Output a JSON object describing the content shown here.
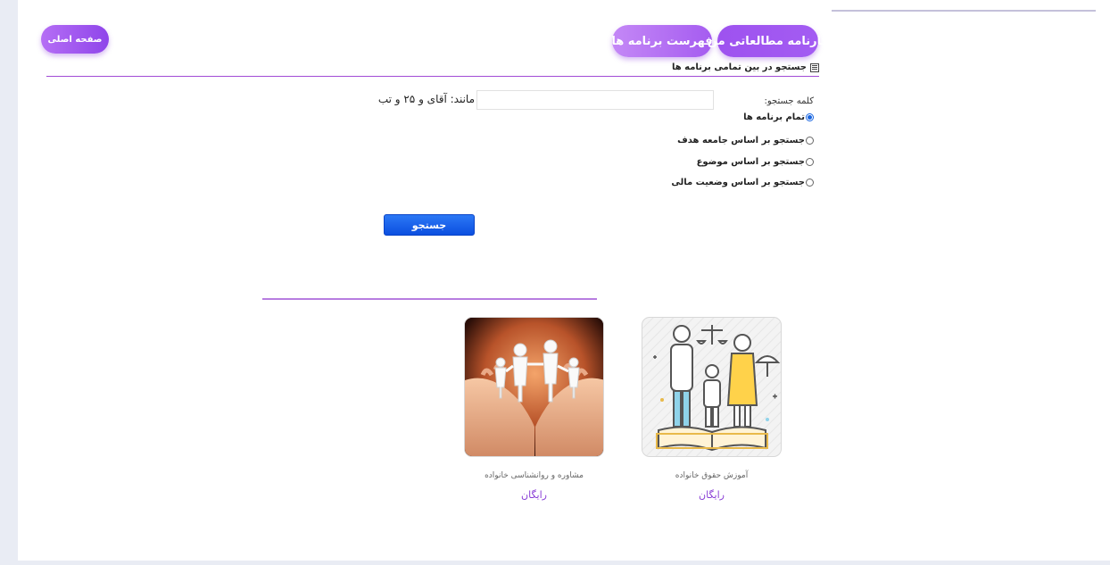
{
  "nav": {
    "home_label": "صفحه اصلی",
    "program_list_label": "فهرست برنامه ها",
    "my_report_label": "کارنامه مطالعاتی من"
  },
  "search": {
    "section_title": "جستجو در بین تمامی برنامه ها",
    "keyword_label": "کلمه جستجو:",
    "keyword_value": "",
    "keyword_hint": "مانند: آقای و ۲۵ و تب",
    "options": [
      {
        "label": "تمام برنامه ها",
        "checked": true
      },
      {
        "label": "جستجو بر اساس جامعه هدف",
        "checked": false
      },
      {
        "label": "جستجو بر اساس موضوع",
        "checked": false
      },
      {
        "label": "جستجو بر اساس وضعیت مالی",
        "checked": false
      }
    ],
    "button_label": "جستجو"
  },
  "programs": [
    {
      "title": "آموزش حقوق خانواده",
      "price": "رایگان",
      "image_icon": "family-law-illustration"
    },
    {
      "title": "مشاوره و روانشناسی خانواده",
      "price": "رایگان",
      "image_icon": "family-hands-photo"
    }
  ],
  "colors": {
    "accent_purple": "#9b50ef",
    "search_button_blue": "#1a5ee8",
    "price_color": "#8a3fd6"
  }
}
